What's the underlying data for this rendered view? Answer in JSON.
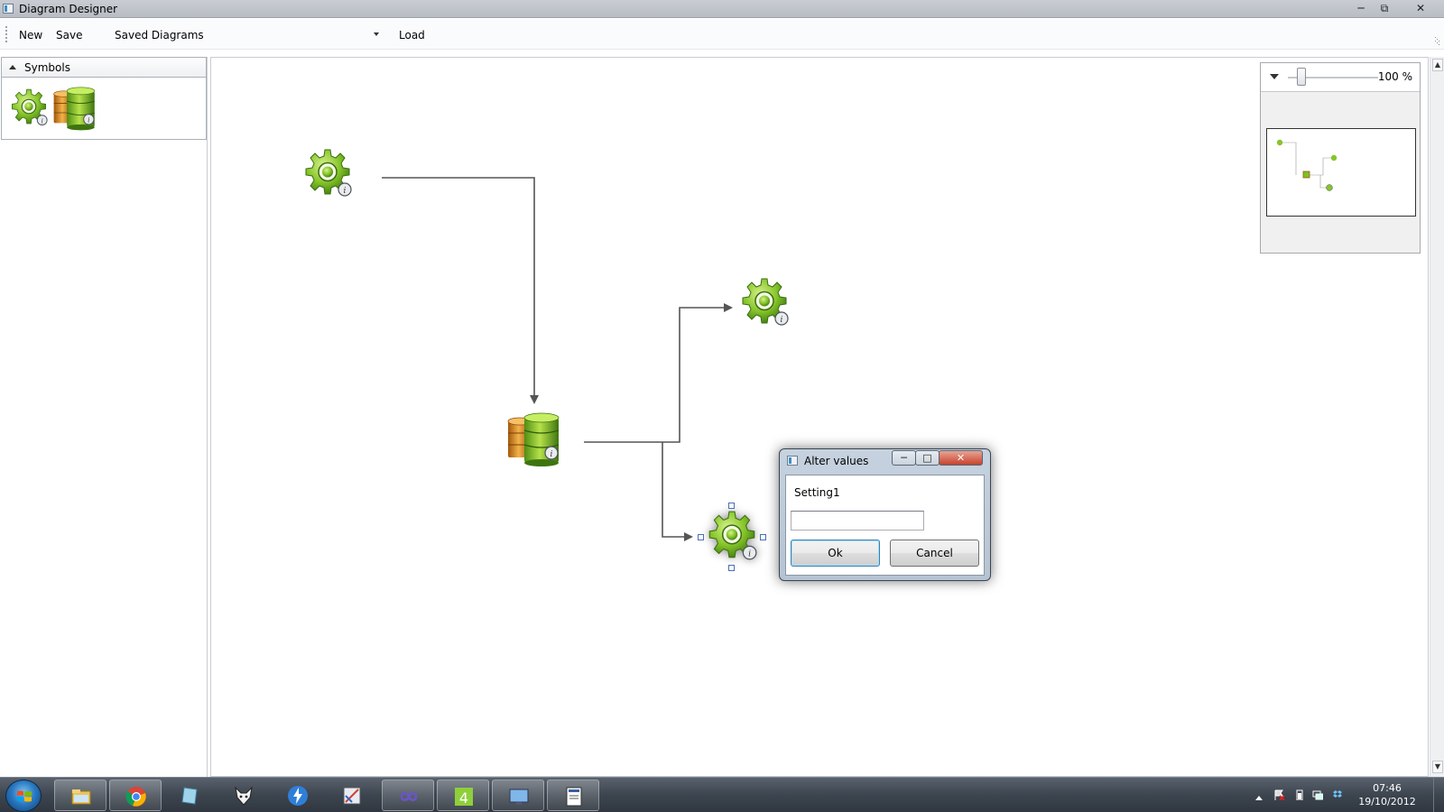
{
  "window": {
    "title": "Diagram Designer",
    "controls": [
      "minimize",
      "maximize",
      "close"
    ]
  },
  "toolbar": {
    "new_label": "New",
    "save_label": "Save",
    "saved_diagrams_label": "Saved Diagrams",
    "saved_diagrams_value": "",
    "load_label": "Load"
  },
  "symbols": {
    "header": "Symbols",
    "items": [
      {
        "name": "gear",
        "icon": "gear-icon"
      },
      {
        "name": "database",
        "icon": "database-icon"
      }
    ]
  },
  "canvas": {
    "nodes": [
      {
        "id": "gear-top",
        "type": "gear",
        "selected": false
      },
      {
        "id": "database-center",
        "type": "database",
        "selected": false
      },
      {
        "id": "gear-right",
        "type": "gear",
        "selected": false
      },
      {
        "id": "gear-bottom",
        "type": "gear",
        "selected": true
      }
    ],
    "connections": [
      {
        "from": "gear-top",
        "to": "database-center"
      },
      {
        "from": "database-center",
        "to": "gear-right"
      },
      {
        "from": "database-center",
        "to": "gear-bottom"
      }
    ]
  },
  "zoom": {
    "level_text": "100 %",
    "value": 1.0
  },
  "dialog": {
    "title": "Alter values",
    "setting_label": "Setting1",
    "input_value": "",
    "ok_label": "Ok",
    "cancel_label": "Cancel"
  },
  "taskbar": {
    "apps": [
      "windows-explorer",
      "chrome",
      "app-blue-slate",
      "fox-app",
      "lightning-app",
      "paint-app",
      "infinity-app",
      "vs4-app",
      "desktop-app",
      "document-app"
    ],
    "clock_time": "07:46",
    "clock_date": "19/10/2012"
  },
  "colors": {
    "gear_green": "#7cc124",
    "db_orange": "#d98b1e",
    "connector": "#555555",
    "selection_handle": "#4a6fb5"
  }
}
